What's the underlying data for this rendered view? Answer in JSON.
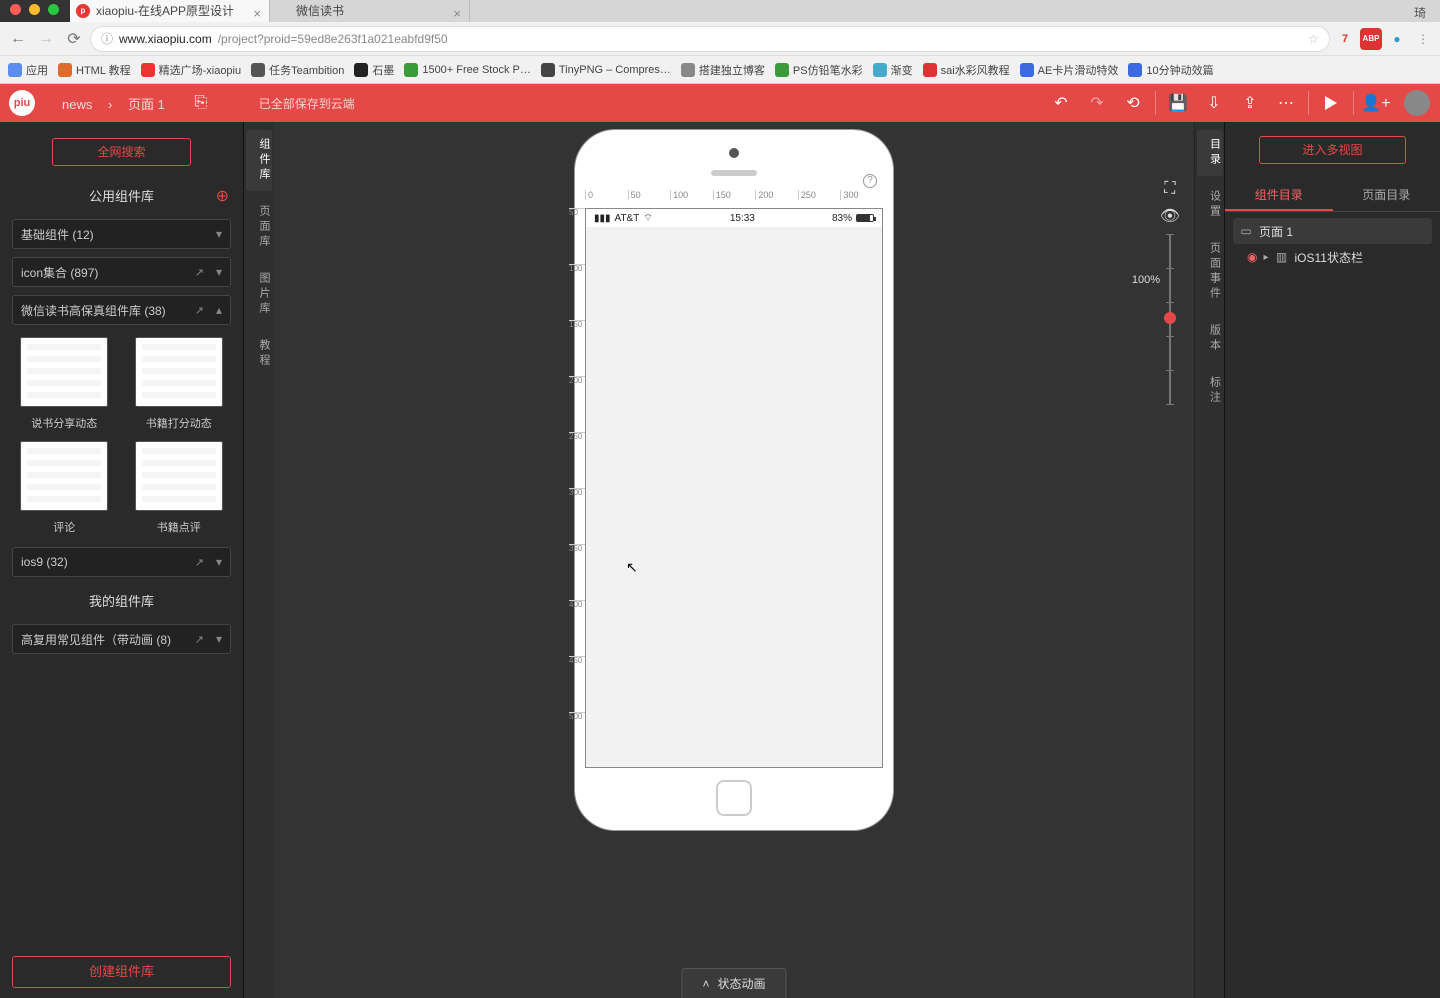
{
  "browser": {
    "tabs": [
      {
        "title": "xiaopiu-在线APP原型设计"
      },
      {
        "title": "微信读书"
      }
    ],
    "profile": "琦",
    "url_host": "www.xiaopiu.com",
    "url_path": "/project?proid=59ed8e263f1a021eabfd9f50",
    "bookmarks": [
      {
        "label": "应用",
        "color": "#5b8def"
      },
      {
        "label": "HTML 教程",
        "color": "#e06b2c"
      },
      {
        "label": "精选广场-xiaopiu",
        "color": "#e33"
      },
      {
        "label": "任务Teambition",
        "color": "#555"
      },
      {
        "label": "石墨",
        "color": "#222"
      },
      {
        "label": "1500+ Free Stock P…",
        "color": "#3b9b3b"
      },
      {
        "label": "TinyPNG – Compres…",
        "color": "#444"
      },
      {
        "label": "搭建独立博客",
        "color": "#888"
      },
      {
        "label": "PS仿铅笔水彩",
        "color": "#3b9b3b"
      },
      {
        "label": "渐变",
        "color": "#4ac"
      },
      {
        "label": "sai水彩风教程",
        "color": "#d33"
      },
      {
        "label": "AE卡片滑动特效",
        "color": "#3b6bdd"
      },
      {
        "label": "10分钟动效篇",
        "color": "#3b6bdd"
      }
    ]
  },
  "header": {
    "crumb_project": "news",
    "crumb_page": "页面 1",
    "saved": "已全部保存到云端"
  },
  "left": {
    "search": "全网搜索",
    "public_title": "公用组件库",
    "groups": {
      "basic": "基础组件 (12)",
      "icon": "icon集合 (897)",
      "wechat": "微信读书高保真组件库 (38)",
      "ios9": "ios9 (32)"
    },
    "thumbs": [
      "说书分享动态",
      "书籍打分动态",
      "评论",
      "书籍点评"
    ],
    "my_title": "我的组件库",
    "my_group": "高复用常见组件（带动画 (8)",
    "create": "创建组件库"
  },
  "vtabs_left": [
    "组件库",
    "页面库",
    "图片库",
    "教程"
  ],
  "vtabs_right": [
    "目录",
    "设置",
    "页面事件",
    "版本",
    "标注"
  ],
  "canvas": {
    "ruler_marks": [
      "0",
      "50",
      "100",
      "150",
      "200",
      "250",
      "300"
    ],
    "ruler_v": [
      "50",
      "100",
      "150",
      "200",
      "250",
      "300",
      "350",
      "400",
      "450",
      "500"
    ],
    "carrier": "AT&T",
    "time": "15:33",
    "battery": "83%",
    "zoom": "100%",
    "status_panel": "状态动画"
  },
  "right": {
    "multi": "进入多视图",
    "tab_comp": "组件目录",
    "tab_page": "页面目录",
    "tree_page": "页面 1",
    "tree_status": "iOS11状态栏"
  }
}
